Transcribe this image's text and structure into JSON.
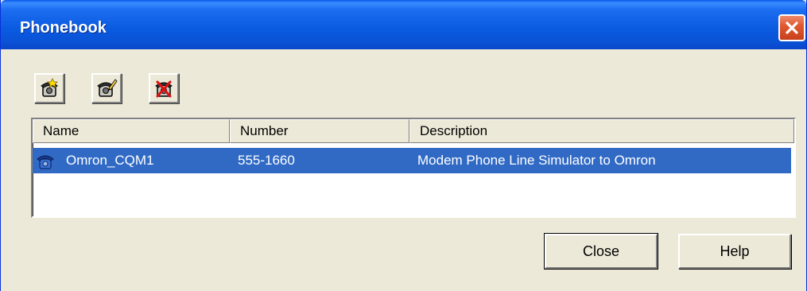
{
  "window": {
    "title": "Phonebook"
  },
  "toolbar": {
    "buttons": [
      {
        "name": "new-entry",
        "icon": "phone-new-icon"
      },
      {
        "name": "edit-entry",
        "icon": "phone-edit-icon"
      },
      {
        "name": "delete-entry",
        "icon": "phone-delete-icon"
      }
    ]
  },
  "list": {
    "columns": [
      "Name",
      "Number",
      "Description"
    ],
    "rows": [
      {
        "name": "Omron_CQM1",
        "number": "555-1660",
        "description": "Modem Phone Line Simulator  to Omron",
        "icon": "phone-icon",
        "selected": true
      }
    ]
  },
  "buttons": {
    "close": "Close",
    "help": "Help"
  },
  "colors": {
    "title_bar": "#0a5ae0",
    "selection": "#316ac5",
    "close_button": "#e05a32",
    "dialog_bg": "#ece9d8"
  }
}
